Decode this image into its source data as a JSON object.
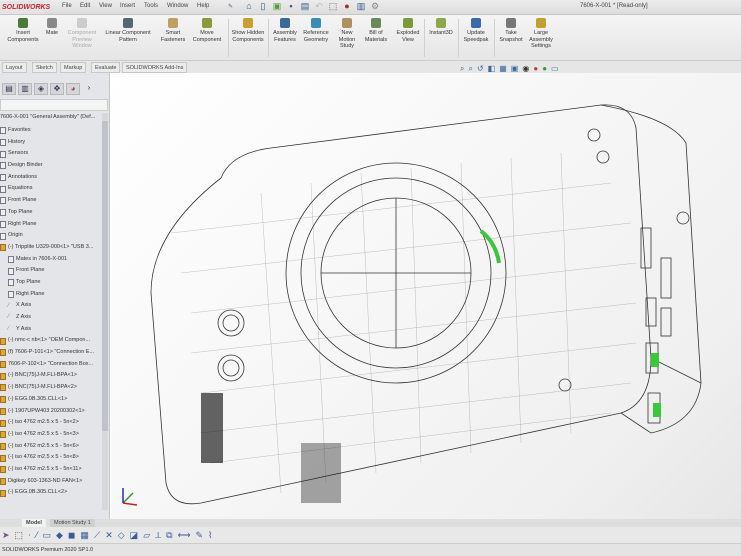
{
  "app": {
    "logo": "SOLIDWORKS",
    "title": "7606-X-001 * [Read-only]",
    "status": "SOLIDWORKS Premium 2020 SP1.0"
  },
  "menu": [
    "File",
    "Edit",
    "View",
    "Insert",
    "Tools",
    "Window",
    "Help"
  ],
  "command_manager": [
    {
      "label": "Insert Components",
      "color": "#4a7a3a"
    },
    {
      "label": "Mate",
      "color": "#888888"
    },
    {
      "label": "Component Preview Window",
      "color": "#bbbbbb",
      "disabled": true
    },
    {
      "label": "Linear Component Pattern",
      "color": "#556677"
    },
    {
      "label": "Smart Fasteners",
      "color": "#c0a060"
    },
    {
      "label": "Move Component",
      "color": "#8a9a3a"
    },
    {
      "label": "Show Hidden Components",
      "color": "#c8a030"
    },
    {
      "label": "Assembly Features",
      "color": "#3a6a9a"
    },
    {
      "label": "Reference Geometry",
      "color": "#3a8aba"
    },
    {
      "label": "New Motion Study",
      "color": "#b09060"
    },
    {
      "label": "Bill of Materials",
      "color": "#6a8a5a"
    },
    {
      "label": "Exploded View",
      "color": "#7a9a3a"
    },
    {
      "label": "Instant3D",
      "color": "#8aaa4a"
    },
    {
      "label": "Update Speedpak",
      "color": "#3a6aaa"
    },
    {
      "label": "Take Snapshot",
      "color": "#777777"
    },
    {
      "label": "Large Assembly Settings",
      "color": "#c0a030"
    }
  ],
  "tabs": [
    "Layout",
    "Sketch",
    "Markup",
    "Evaluate",
    "SOLIDWORKS Add-Ins"
  ],
  "tree": {
    "root": "7606-X-001 \"General Assembly\" (Def...",
    "items": [
      {
        "label": "Favorites",
        "icon": "folder"
      },
      {
        "label": "History",
        "icon": "folder"
      },
      {
        "label": "Sensors",
        "icon": "folder"
      },
      {
        "label": "Design Binder",
        "icon": "folder"
      },
      {
        "label": "Annotations",
        "icon": "folder"
      },
      {
        "label": "Equations",
        "icon": "folder"
      },
      {
        "label": "Front Plane",
        "icon": "plane"
      },
      {
        "label": "Top Plane",
        "icon": "plane"
      },
      {
        "label": "Right Plane",
        "icon": "plane"
      },
      {
        "label": "Origin",
        "icon": "origin"
      },
      {
        "label": "(-) Tripplite U329-000<1> \"USB 3...",
        "icon": "part"
      },
      {
        "label": "Mates in 7606-X-001",
        "icon": "mates",
        "indent": 1
      },
      {
        "label": "Front Plane",
        "icon": "plane",
        "indent": 1
      },
      {
        "label": "Top Plane",
        "icon": "plane",
        "indent": 1
      },
      {
        "label": "Right Plane",
        "icon": "plane",
        "indent": 1
      },
      {
        "label": "X Axis",
        "icon": "axis",
        "indent": 1
      },
      {
        "label": "Z Axis",
        "icon": "axis",
        "indent": 1
      },
      {
        "label": "Y Axis",
        "icon": "axis",
        "indent": 1
      },
      {
        "label": "(-) nmc-c nb<1> \"OEM Compon...",
        "icon": "part"
      },
      {
        "label": "(f) 7606-P-101<1> \"Connection E...",
        "icon": "part"
      },
      {
        "label": "7606-P-102<1> \"Connection Box...",
        "icon": "part"
      },
      {
        "label": "(-) BNC(75)J-M.FLI-BPA<1>",
        "icon": "part"
      },
      {
        "label": "(-) BNC(75)J-M.FLI-BPA<2>",
        "icon": "part"
      },
      {
        "label": "(-) EGG.0B.305.CLL<1>",
        "icon": "part"
      },
      {
        "label": "(-) 1907UPW403 20200302<1>",
        "icon": "part"
      },
      {
        "label": "(-) iso 4762 m2.5 x 5 - 5n<2>",
        "icon": "part"
      },
      {
        "label": "(-) iso 4762 m2.5 x 5 - 5n<3>",
        "icon": "part"
      },
      {
        "label": "(-) iso 4762 m2.5 x 5 - 5n<6>",
        "icon": "part"
      },
      {
        "label": "(-) iso 4762 m2.5 x 5 - 5n<8>",
        "icon": "part"
      },
      {
        "label": "(-) iso 4762 m2.5 x 5 - 5n<11>",
        "icon": "part"
      },
      {
        "label": "Digikey 603-1363-ND FAN<1>",
        "icon": "part"
      },
      {
        "label": "(-) EGG.0B.305.CLL<2>",
        "icon": "part"
      }
    ]
  },
  "bottom_tabs": [
    "Model",
    "Motion Study 1"
  ]
}
